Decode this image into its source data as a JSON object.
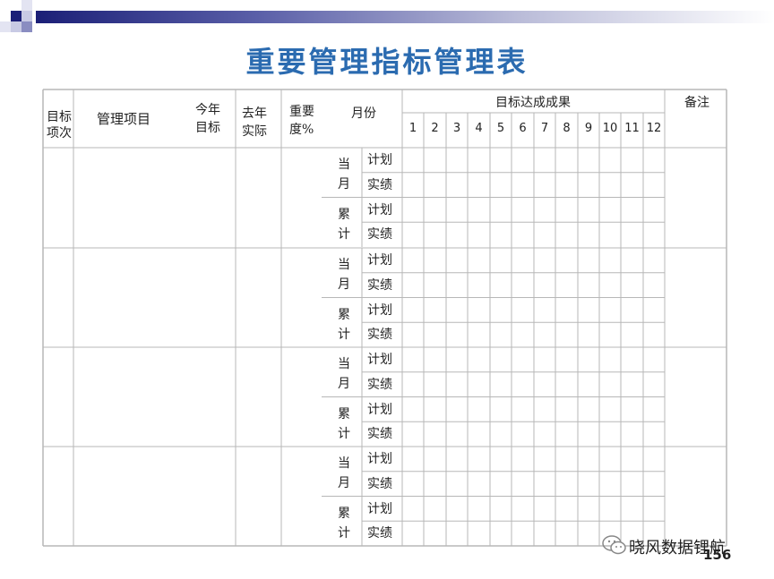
{
  "title": "重要管理指标管理表",
  "headers": {
    "item_no": "目标\n项次",
    "item": "管理项目",
    "this_year_target": "今年\n目标",
    "last_year_actual": "去年\n实际",
    "weight": "重要\n度%",
    "month": "月份",
    "results": "目标达成成果",
    "months": [
      "1",
      "2",
      "3",
      "4",
      "5",
      "6",
      "7",
      "8",
      "9",
      "10",
      "11",
      "12"
    ],
    "remarks": "备注"
  },
  "labels": {
    "current_month": "当月",
    "cumulative": "累计",
    "plan": "计划",
    "actual": "实绩"
  },
  "groups": 4,
  "watermark": {
    "brand": "晓风数据锂航",
    "page": "156"
  },
  "colors": {
    "title": "#2b6bb0",
    "band": "#1b1f77",
    "grid": "#b7b7b7"
  }
}
